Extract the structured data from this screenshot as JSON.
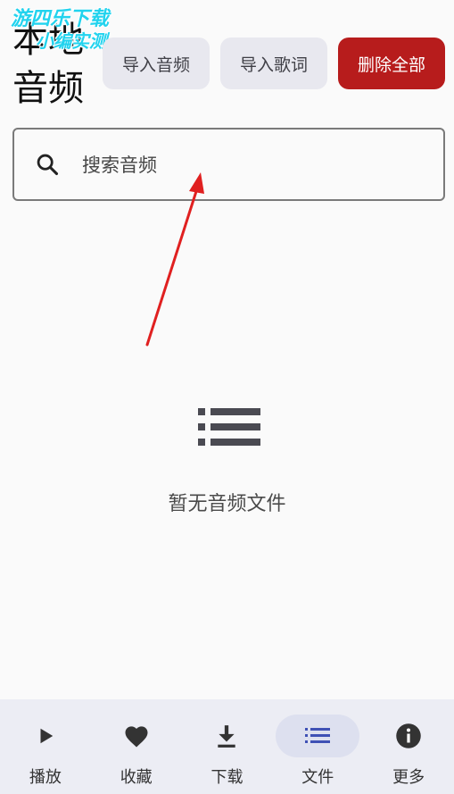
{
  "header": {
    "title": "本地音频",
    "buttons": {
      "import_audio": "导入音频",
      "import_lyrics": "导入歌词",
      "delete_all": "删除全部"
    }
  },
  "search": {
    "placeholder": "搜索音频"
  },
  "empty_state": {
    "icon": "list-icon",
    "message": "暂无音频文件"
  },
  "watermark": {
    "line1": "游四乐下载",
    "line2": "小编实测"
  },
  "nav": {
    "items": [
      {
        "label": "播放",
        "icon": "play-icon"
      },
      {
        "label": "收藏",
        "icon": "heart-icon"
      },
      {
        "label": "下载",
        "icon": "download-icon"
      },
      {
        "label": "文件",
        "icon": "list-icon",
        "active": true
      },
      {
        "label": "更多",
        "icon": "info-icon"
      }
    ]
  },
  "colors": {
    "danger": "#b71c1c",
    "nav_bg": "#ecedf4",
    "active_pill": "#dde0ef",
    "active_icon": "#3f51b5",
    "annotation_arrow": "#e02020"
  }
}
